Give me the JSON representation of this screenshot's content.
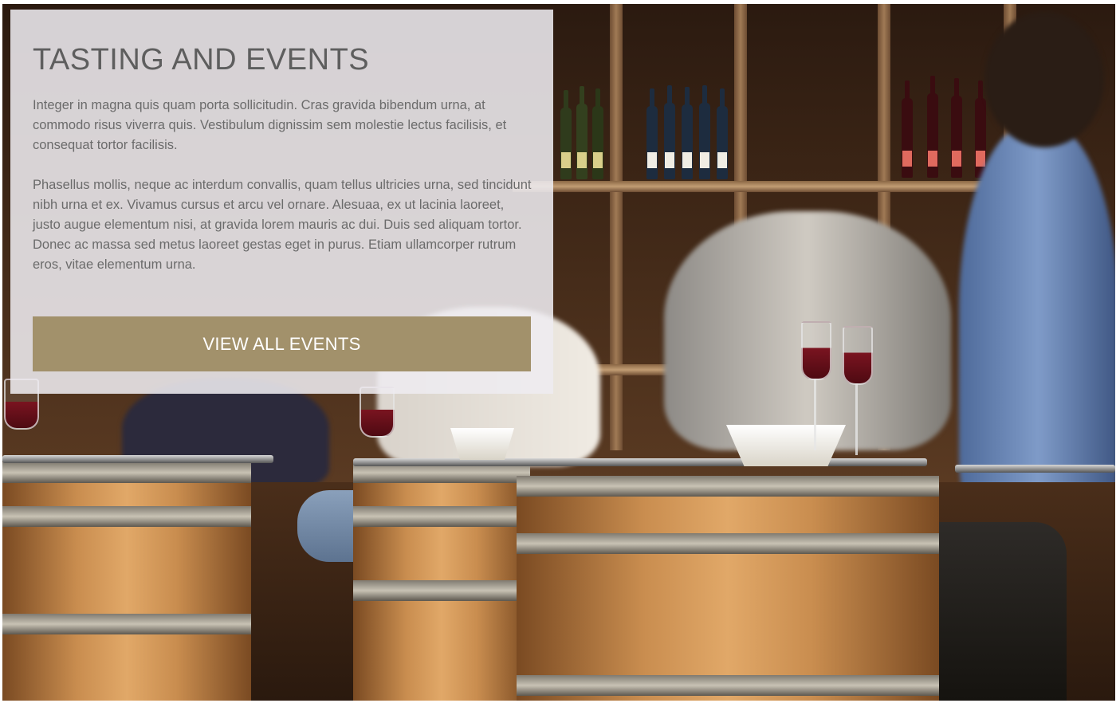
{
  "section": {
    "title": "TASTING AND EVENTS",
    "paragraphs": [
      "Integer in magna quis quam porta sollicitudin. Cras gravida bibendum urna, at commodo risus viverra quis. Vestibulum dignissim sem molestie lectus facilisis, et consequat tortor facilisis.",
      "Phasellus mollis, neque ac interdum convallis, quam tellus ultricies urna, sed tincidunt nibh urna et ex. Vivamus cursus et arcu vel ornare. Alesuaa, ex ut lacinia laoreet, justo augue elementum nisi, at gravida lorem mauris ac dui. Duis sed aliquam tortor. Donec ac massa sed metus laoreet gestas eget in purus. Etiam ullamcorper rutrum eros, vitae elementum urna."
    ],
    "cta_label": "VIEW ALL EVENTS"
  },
  "theme": {
    "panel_background": "#eeecf0",
    "title_color": "#5e5e5e",
    "text_color": "#6b6b6b",
    "button_color": "#a2916b",
    "button_text_color": "#ffffff"
  },
  "background": {
    "icon": "wine-bar-photo-icon"
  }
}
